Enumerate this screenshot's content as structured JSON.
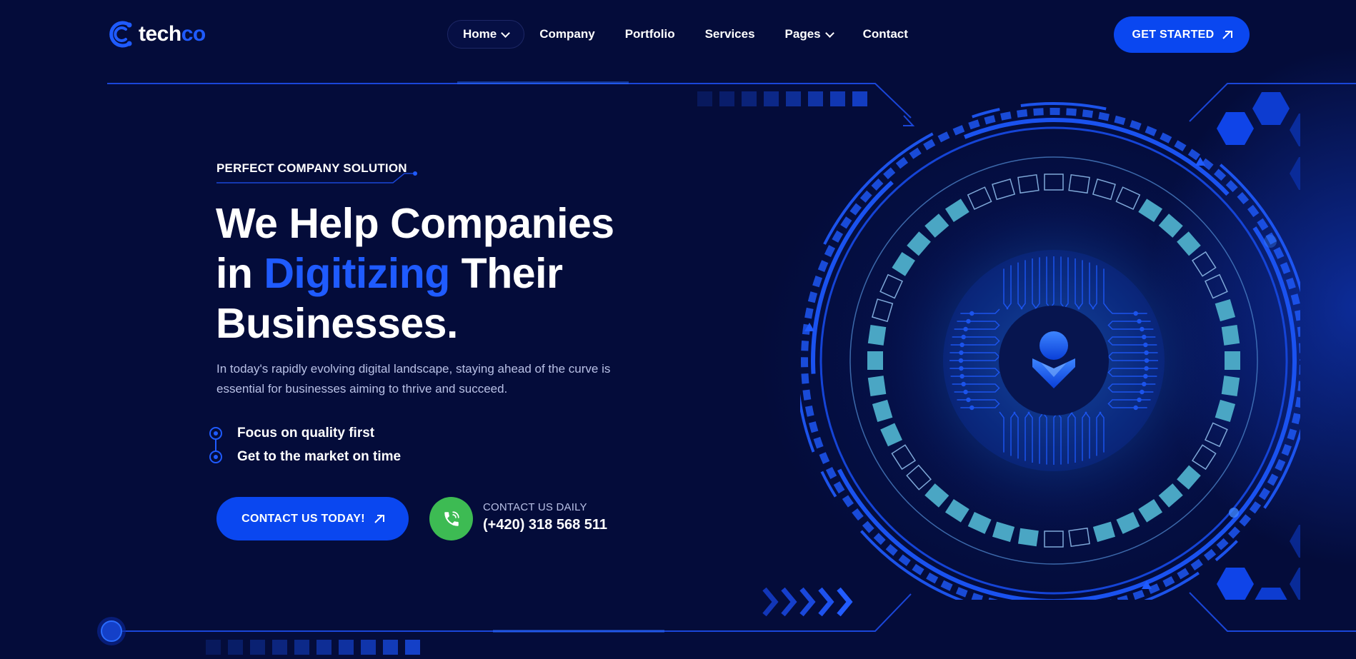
{
  "brand": {
    "logo_text_white": "tech",
    "logo_text_blue": "co"
  },
  "nav": {
    "items": [
      {
        "label": "Home",
        "dropdown": true,
        "active": true
      },
      {
        "label": "Company",
        "dropdown": false
      },
      {
        "label": "Portfolio",
        "dropdown": false
      },
      {
        "label": "Services",
        "dropdown": false
      },
      {
        "label": "Pages",
        "dropdown": true
      },
      {
        "label": "Contact",
        "dropdown": false
      }
    ]
  },
  "header": {
    "cta_label": "GET STARTED"
  },
  "hero": {
    "tagline": "PERFECT COMPANY SOLUTION",
    "headline_line1": "We Help Companies",
    "headline_in": "in ",
    "headline_highlight": "Digitizing",
    "headline_their": " Their",
    "headline_line3": "Businesses.",
    "description": "In today's rapidly evolving digital landscape, staying ahead of the curve is essential for businesses aiming to thrive and succeed.",
    "features": [
      "Focus on quality first",
      "Get to the market on time"
    ],
    "contact_button_label": "CONTACT US TODAY!",
    "contact_label": "CONTACT US DAILY",
    "contact_phone": "(+420) 318 568 511"
  },
  "colors": {
    "background": "#040c3a",
    "accent_blue": "#0a47f0",
    "highlight_blue": "#1f5bff",
    "phone_green": "#3dbb53",
    "teal": "#4aa6c4"
  },
  "icons": {
    "logo": "techco-logo-icon",
    "arrow": "arrow-up-right-icon",
    "phone": "phone-icon",
    "feature": "target-dot-icon",
    "center": "user-shield-icon"
  }
}
